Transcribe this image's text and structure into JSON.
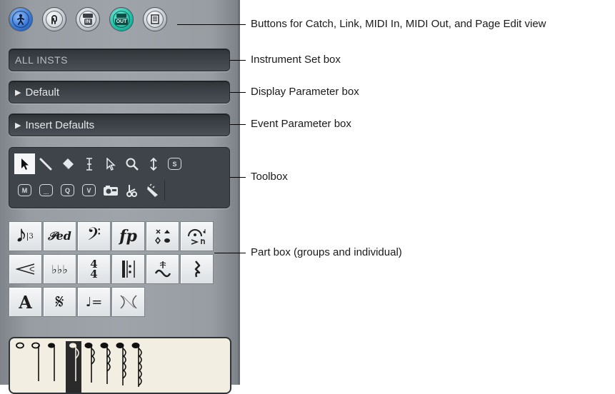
{
  "panel": {
    "top_buttons": [
      {
        "name": "catch-button",
        "icon": "catch-runner-icon",
        "color": "blue"
      },
      {
        "name": "link-button",
        "icon": "link-icon",
        "color": "gray"
      },
      {
        "name": "midi-in-button",
        "icon": "midi-in-icon",
        "text": "IN",
        "color": "gray"
      },
      {
        "name": "midi-out-button",
        "icon": "midi-out-icon",
        "text": "OUT",
        "color": "teal"
      },
      {
        "name": "page-edit-button",
        "icon": "page-icon",
        "color": "gray"
      }
    ],
    "instrument_set": "ALL INSTS",
    "display_parameter": "Default",
    "event_parameter": "Insert Defaults",
    "toolbox": {
      "tools": [
        "pointer-tool",
        "pencil-tool",
        "eraser-tool",
        "text-tool",
        "layout-tool",
        "zoom-tool",
        "resize-tool",
        "solo-tool",
        "mute-tool",
        "marquee-tool",
        "quantize-tool",
        "velocity-tool",
        "camera-tool",
        "scissors-tool",
        "glue-tool"
      ],
      "key_labels": {
        "solo": "S",
        "mute": "M",
        "quantize": "Q",
        "velocity": "V"
      }
    },
    "part_box": {
      "cells": [
        {
          "name": "notes-group",
          "symbol": "𝅘𝅥𝅮",
          "sub": "3"
        },
        {
          "name": "pedal-group",
          "symbol": "𝒫𝑒𝒹."
        },
        {
          "name": "clef-group",
          "symbol": "𝄢"
        },
        {
          "name": "dynamics-group",
          "symbol": "fp"
        },
        {
          "name": "noteheads-group",
          "symbol": "×▲"
        },
        {
          "name": "fermata-group",
          "symbol": "𝄐"
        },
        {
          "name": "crescendo-group",
          "symbol": "<"
        },
        {
          "name": "key-signature-group",
          "symbol": "♭♭♭"
        },
        {
          "name": "time-signature-group",
          "symbol": "4/4"
        },
        {
          "name": "barline-group",
          "symbol": "𝄆"
        },
        {
          "name": "ornaments-group",
          "symbol": "𝆗"
        },
        {
          "name": "rests-group",
          "symbol": "𝄽"
        },
        {
          "name": "text-group",
          "symbol": "A"
        },
        {
          "name": "segno-group",
          "symbol": "𝄋"
        },
        {
          "name": "tempo-group",
          "symbol": "♩="
        },
        {
          "name": "lines-group",
          "symbol": ")("
        }
      ]
    }
  },
  "annotations": {
    "buttons": "Buttons for Catch, Link, MIDI In, MIDI Out, and Page Edit view",
    "instrument_set": "Instrument Set box",
    "display_parameter": "Display Parameter box",
    "event_parameter": "Event Parameter box",
    "toolbox": "Toolbox",
    "part_box": "Part box (groups and individual)"
  },
  "colors": {
    "panel": "#9ea4a9",
    "box_dark": "#3e4449",
    "catch_blue": "#3578d8",
    "midi_out_teal": "#1fbca5",
    "score_paper": "#f3eee2"
  }
}
